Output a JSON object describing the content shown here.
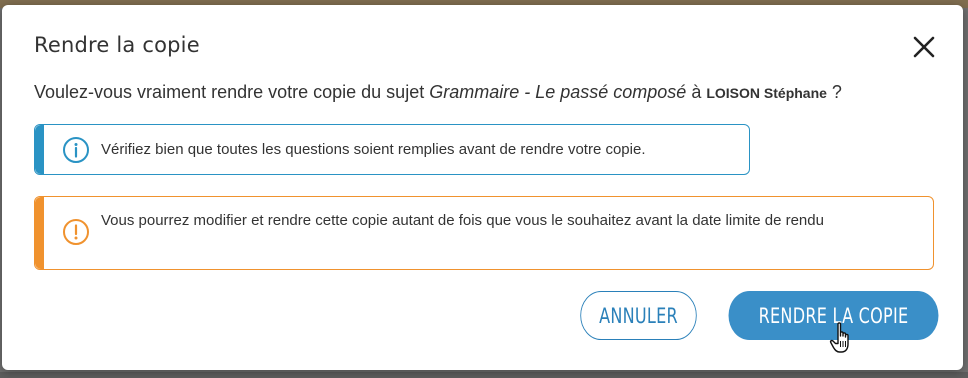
{
  "dialog": {
    "title": "Rendre la copie",
    "question": {
      "prefix": "Voulez-vous vraiment rendre votre copie du sujet ",
      "subject": "Grammaire - Le passé composé",
      "middle": " à ",
      "person": "LOISON Stéphane",
      "suffix": " ?"
    },
    "info_notice": {
      "icon": "info-circle-icon",
      "text": "Vérifiez bien que toutes les questions soient remplies avant de rendre votre copie."
    },
    "warning_notice": {
      "icon": "exclamation-circle-icon",
      "text": "Vous pourrez modifier et rendre cette copie autant de fois que vous le souhaitez avant la date limite de rendu"
    },
    "buttons": {
      "cancel": "ANNULER",
      "submit": "RENDRE LA COPIE"
    },
    "close_icon": "close-icon"
  },
  "colors": {
    "info": "#2a93c4",
    "warning": "#f0922e",
    "primary": "#3a8fc8",
    "text": "#333333"
  }
}
